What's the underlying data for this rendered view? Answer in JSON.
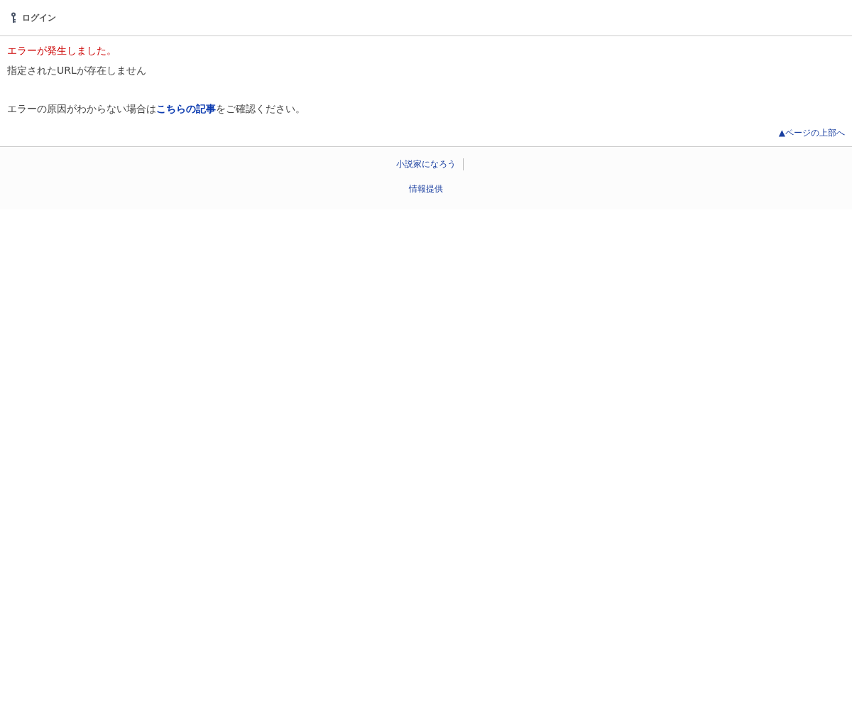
{
  "header": {
    "login": "ログイン"
  },
  "error": {
    "title": "エラーが発生しました。",
    "message": "指定されたURLが存在しません",
    "help_before": "エラーの原因がわからない場合は",
    "help_link": "こちらの記事",
    "help_after": "をご確認ください。"
  },
  "page_top": "▲ページの上部へ",
  "footer": {
    "links": [
      "小説家になろう"
    ],
    "info": "情報提供"
  }
}
